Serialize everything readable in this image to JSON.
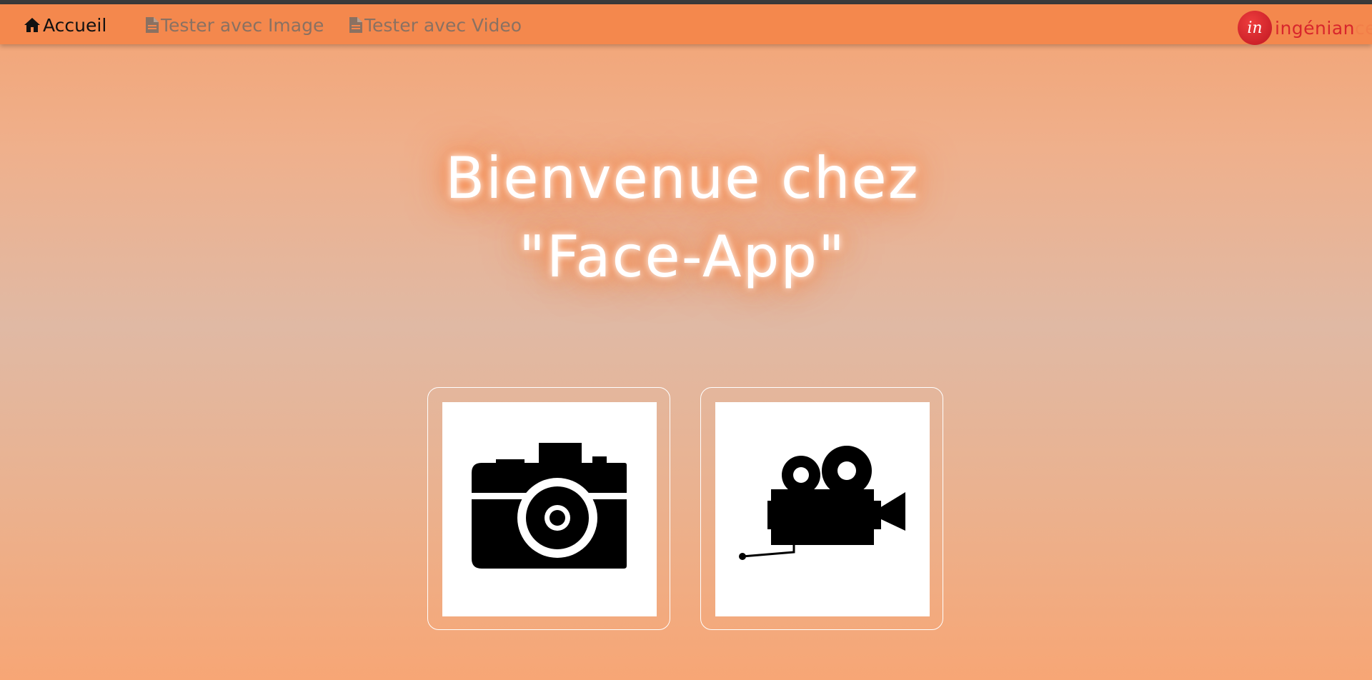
{
  "nav": {
    "home_label": "Accueil",
    "home_icon": "home-icon",
    "image_label": "Tester avec Image",
    "image_icon": "document-icon",
    "video_label": "Tester avec Video",
    "video_icon": "document-icon"
  },
  "brand": {
    "logo_letters": "in",
    "name_main": "ingénian",
    "name_tail": "ce"
  },
  "hero": {
    "title_line1": "Bienvenue chez",
    "title_line2": "\"Face-App\""
  },
  "cards": [
    {
      "icon": "camera-icon"
    },
    {
      "icon": "movie-camera-icon"
    }
  ],
  "colors": {
    "navbar": "#f4884d",
    "brand_red": "#d8262c",
    "brand_orange": "#f27e48",
    "title_glow": "#f47a3e"
  }
}
